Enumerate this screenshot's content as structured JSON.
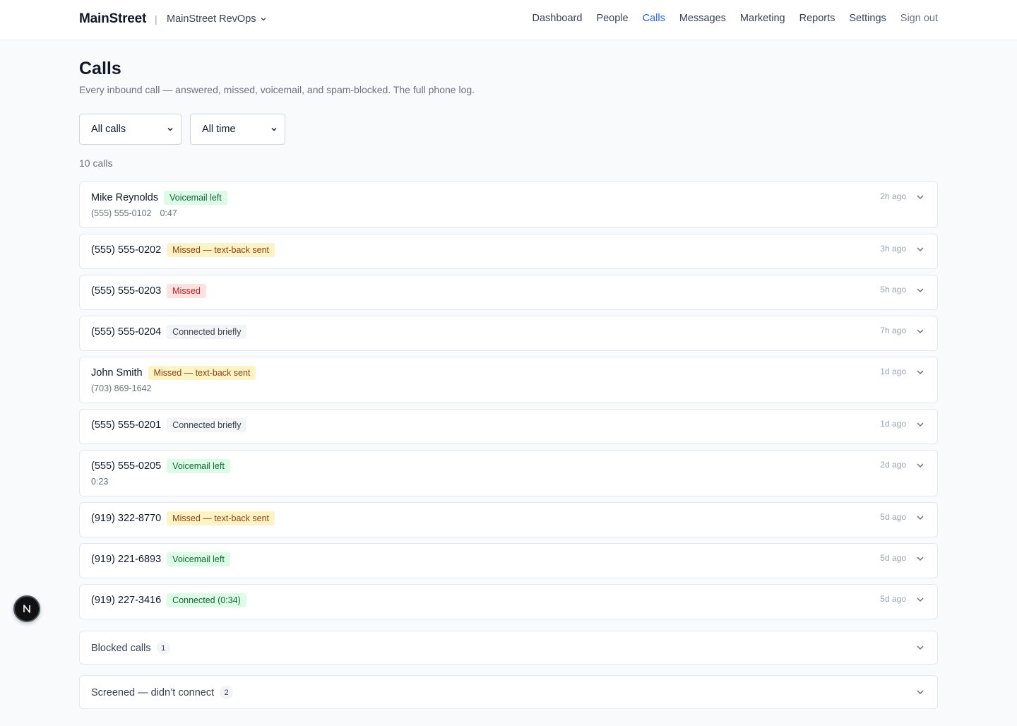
{
  "header": {
    "brand": "MainStreet",
    "separator": "|",
    "org": "MainStreet RevOps",
    "nav": [
      "Dashboard",
      "People",
      "Calls",
      "Messages",
      "Marketing",
      "Reports",
      "Settings"
    ],
    "active_nav": "Calls",
    "signout": "Sign out"
  },
  "page": {
    "title": "Calls",
    "subtitle": "Every inbound call — answered, missed, voicemail, and spam-blocked. The full phone log.",
    "filter_type": "All calls",
    "filter_time": "All time",
    "count": "10 calls"
  },
  "calls": [
    {
      "caller": "Mike Reynolds",
      "badge": "Voicemail left",
      "tone": "green",
      "phone": "(555) 555-0102",
      "duration": "0:47",
      "time": "2h ago"
    },
    {
      "caller": "(555) 555-0202",
      "badge": "Missed — text-back sent",
      "tone": "yellow",
      "phone": "",
      "duration": "",
      "time": "3h ago"
    },
    {
      "caller": "(555) 555-0203",
      "badge": "Missed",
      "tone": "red",
      "phone": "",
      "duration": "",
      "time": "5h ago"
    },
    {
      "caller": "(555) 555-0204",
      "badge": "Connected briefly",
      "tone": "gray",
      "phone": "",
      "duration": "",
      "time": "7h ago"
    },
    {
      "caller": "John Smith",
      "badge": "Missed — text-back sent",
      "tone": "yellow",
      "phone": "(703) 869-1642",
      "duration": "",
      "time": "1d ago"
    },
    {
      "caller": "(555) 555-0201",
      "badge": "Connected briefly",
      "tone": "gray",
      "phone": "",
      "duration": "",
      "time": "1d ago"
    },
    {
      "caller": "(555) 555-0205",
      "badge": "Voicemail left",
      "tone": "green",
      "phone": "",
      "duration": "0:23",
      "time": "2d ago"
    },
    {
      "caller": "(919) 322-8770",
      "badge": "Missed — text-back sent",
      "tone": "yellow",
      "phone": "",
      "duration": "",
      "time": "5d ago"
    },
    {
      "caller": "(919) 221-6893",
      "badge": "Voicemail left",
      "tone": "green",
      "phone": "",
      "duration": "",
      "time": "5d ago"
    },
    {
      "caller": "(919) 227-3416",
      "badge": "Connected (0:34)",
      "tone": "green",
      "phone": "",
      "duration": "",
      "time": "5d ago"
    }
  ],
  "sections": {
    "blocked_label": "Blocked calls",
    "blocked_count": "1",
    "screened_label": "Screened — didn’t connect",
    "screened_count": "2"
  },
  "colors": {
    "accent": "#2563eb",
    "badge_green_bg": "#dcfce7",
    "badge_yellow_bg": "#fef3c7",
    "badge_red_bg": "#fee2e2",
    "badge_gray_bg": "#f3f4f6"
  },
  "icons": {
    "org_dropdown": "chevron-down-icon",
    "row_expand": "chevron-down-icon",
    "fab": "n-logo-icon"
  }
}
